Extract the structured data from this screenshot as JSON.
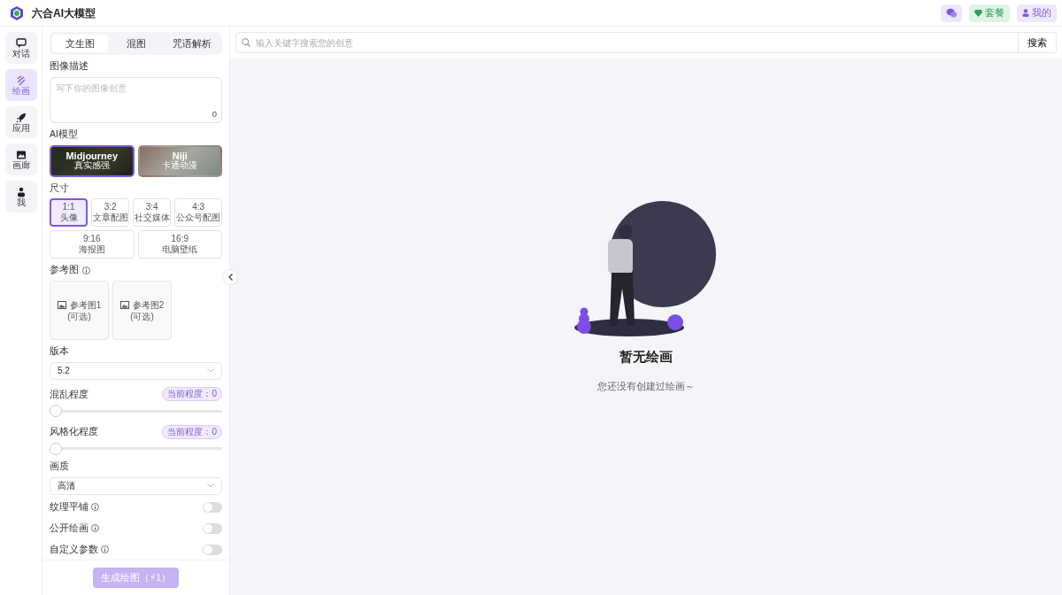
{
  "app": {
    "title": "六合AI大模型"
  },
  "header_buttons": [
    {
      "kind": "icon"
    },
    {
      "kind": "plan",
      "label": "套餐"
    },
    {
      "kind": "user",
      "label": "我的"
    }
  ],
  "nav": [
    {
      "label": "对话",
      "selected": false
    },
    {
      "label": "绘画",
      "selected": true
    },
    {
      "label": "应用",
      "selected": false
    },
    {
      "label": "画廊",
      "selected": false
    },
    {
      "label": "我",
      "selected": false
    }
  ],
  "tabs": [
    {
      "label": "文生图",
      "selected": true
    },
    {
      "label": "混图",
      "selected": false
    },
    {
      "label": "咒语解析",
      "selected": false
    }
  ],
  "prompt": {
    "label": "图像描述",
    "placeholder": "写下你的图像创意",
    "count": "0"
  },
  "model_label": "AI模型",
  "models": [
    {
      "name": "Midjourney",
      "subtitle": "真实感强",
      "selected": true
    },
    {
      "name": "Niji",
      "subtitle": "卡通动漫",
      "selected": false
    }
  ],
  "size_label": "尺寸",
  "sizes": [
    {
      "ratio": "1:1",
      "use": "头像",
      "selected": true
    },
    {
      "ratio": "3:2",
      "use": "文章配图",
      "selected": false
    },
    {
      "ratio": "3:4",
      "use": "社交媒体",
      "selected": false
    },
    {
      "ratio": "4:3",
      "use": "公众号配图",
      "selected": false
    },
    {
      "ratio": "9:16",
      "use": "海报图",
      "selected": false
    },
    {
      "ratio": "16:9",
      "use": "电脑壁纸",
      "selected": false
    }
  ],
  "reference": {
    "label": "参考图",
    "slots": [
      {
        "label": "参考图1",
        "note": "(可选)"
      },
      {
        "label": "参考图2",
        "note": "(可选)"
      }
    ]
  },
  "version": {
    "label": "版本",
    "value": "5.2"
  },
  "sliders": [
    {
      "label": "混乱程度",
      "reading": "当前程度：0",
      "level": 0
    },
    {
      "label": "风格化程度",
      "reading": "当前程度：0",
      "level": 0
    }
  ],
  "quality": {
    "label": "画质",
    "value": "高清"
  },
  "toggles": [
    {
      "label": "纹理平铺",
      "on": false
    },
    {
      "label": "公开绘画",
      "on": false
    },
    {
      "label": "自定义参数",
      "on": false
    }
  ],
  "generate": {
    "label": "生成绘图（⚡1）",
    "disabled": true
  },
  "search": {
    "placeholder": "输入关键字搜索您的创意",
    "button": "搜索"
  },
  "empty": {
    "title": "暂无绘画",
    "message": "您还没有创建过绘画～"
  }
}
